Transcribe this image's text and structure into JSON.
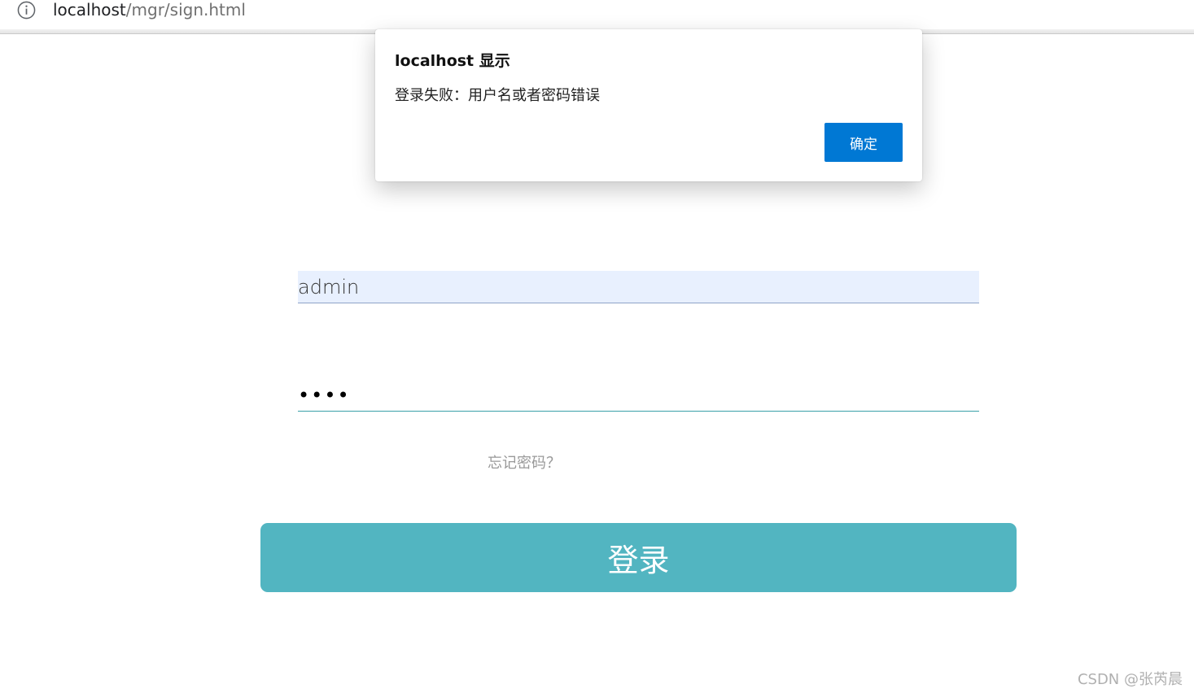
{
  "browser": {
    "url_host": "localhost",
    "url_path": "/mgr/sign.html",
    "info_icon": "info-icon"
  },
  "dialog": {
    "title": "localhost 显示",
    "message": "登录失败：用户名或者密码错误",
    "ok_label": "确定"
  },
  "form": {
    "username_value": "admin",
    "password_value": "abcd",
    "forgot_link": "忘记密码？",
    "login_label": "登录"
  },
  "watermark": "CSDN @张芮晨",
  "colors": {
    "dialog_button": "#0078d4",
    "login_button": "#52b5c1",
    "autofill_bg": "#e8f0fe"
  }
}
